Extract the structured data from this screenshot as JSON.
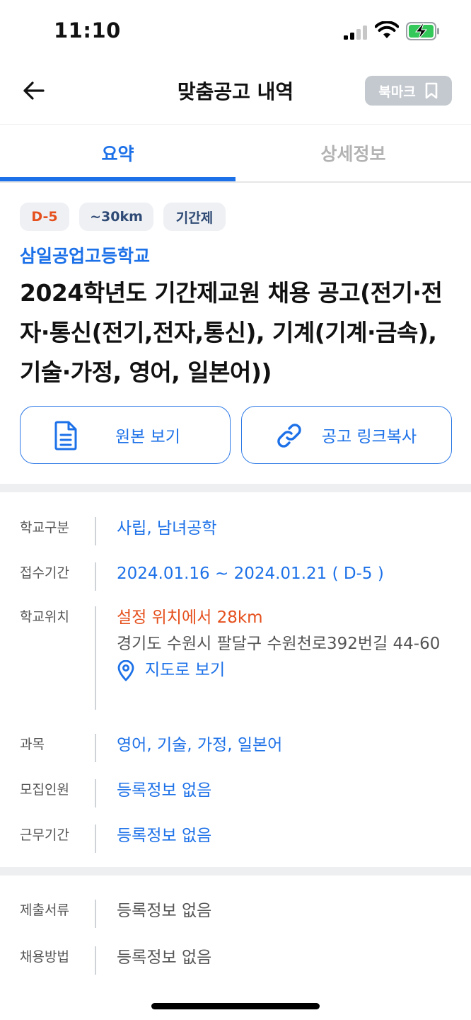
{
  "status": {
    "time": "11:10"
  },
  "nav": {
    "title": "맞춤공고 내역",
    "bookmark_label": "북마크"
  },
  "tabs": [
    {
      "label": "요약"
    },
    {
      "label": "상세정보"
    }
  ],
  "chips": {
    "dday": "D-5",
    "distance": "~30km",
    "type": "기간제"
  },
  "post": {
    "school": "삼일공업고등학교",
    "title": "2024학년도 기간제교원 채용 공고(전기·전자·통신(전기,전자,통신), 기계(기계·금속), 기술·가정, 영어, 일본어))"
  },
  "actions": {
    "original": "원본 보기",
    "copy_link": "공고 링크복사"
  },
  "info": {
    "school_type": {
      "label": "학교구분",
      "value": "사립, 남녀공학"
    },
    "period": {
      "label": "접수기간",
      "value": "2024.01.16 ~ 2024.01.21 ( D-5 )"
    },
    "location": {
      "label": "학교위치",
      "distance": "설정 위치에서 28km",
      "address": "경기도 수원시 팔달구 수원천로392번길 44-60",
      "map_link": "지도로 보기"
    },
    "subjects": {
      "label": "과목",
      "value": "영어, 기술, 가정, 일본어"
    },
    "recruits": {
      "label": "모집인원",
      "value": "등록정보 없음"
    },
    "work_period": {
      "label": "근무기간",
      "value": "등록정보 없음"
    }
  },
  "extra": {
    "documents": {
      "label": "제출서류",
      "value": "등록정보 없음"
    },
    "method": {
      "label": "채용방법",
      "value": "등록정보 없음"
    }
  },
  "colors": {
    "accent": "#1d71e8",
    "warning": "#e5501d",
    "chip_bg": "#eef0f3"
  }
}
